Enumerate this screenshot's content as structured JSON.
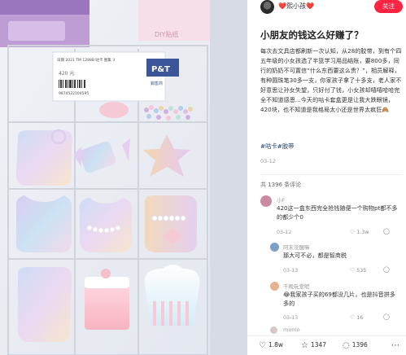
{
  "author": {
    "name": "❤️熙小孩❤️",
    "follow_label": "关注"
  },
  "post": {
    "title": "小朋友的钱这么好赚了？",
    "body": "每次去文具店都刷新一次认知，从28的胶带，到有个四五年级的小女孩选了半篮学习用品结账，要800多，同行的奶奶不可置信“什么东西要这么贵？”，相员解释，有种圆珠笔30多一支，你家孩子拿了十多支，老人家不好意思让孙女失望，只好付了钱，小女孩却嘻嘻哈哈完全不知道感恩...今天的咕卡套盒更是让我大跌眼镜，420块，也不知道是我格局太小还是世界太疯狂🙈",
    "tags": "#咕卡#胶带",
    "date": "03-12",
    "comments_count": "共 1396 条评论"
  },
  "photo": {
    "brand_text": "P&T",
    "brand_sub": "銷售商",
    "price_tag": "420 元",
    "barcode_num": "9874522104595",
    "label_line": "日期 2021 TM 1288B 咕卡 图集 3",
    "box_logo": "DIY贴纸"
  },
  "comments": [
    {
      "name": "小F",
      "text": "420这一盒东西完全抢钱随便一个购物pt都不多的都少个0",
      "date": "03-12",
      "likes": "1.3w",
      "avatar_color": "#c98aa2"
    },
    {
      "name": "阿末没醒嘛",
      "text": "那大可不必，都是智商税",
      "date": "03-13",
      "likes": "535",
      "avatar_color": "#7aa0c8"
    },
    {
      "name": "千晚玩爱呢",
      "text": "😂我家孩子买的69都没几片，也是抖音拼多多的",
      "date": "03-13",
      "likes": "16",
      "avatar_color": "#e6b38f"
    },
    {
      "name": "momo",
      "text": "",
      "date": "",
      "likes": "",
      "avatar_color": "#d9c6c6"
    }
  ],
  "bottom_bar": {
    "likes": "1.8w",
    "collects": "1347",
    "comments": "1396"
  },
  "icons": {
    "like": "heart-outline-icon",
    "collect": "star-outline-icon",
    "comment": "comment-bubble-icon",
    "more": "ellipsis-icon"
  }
}
